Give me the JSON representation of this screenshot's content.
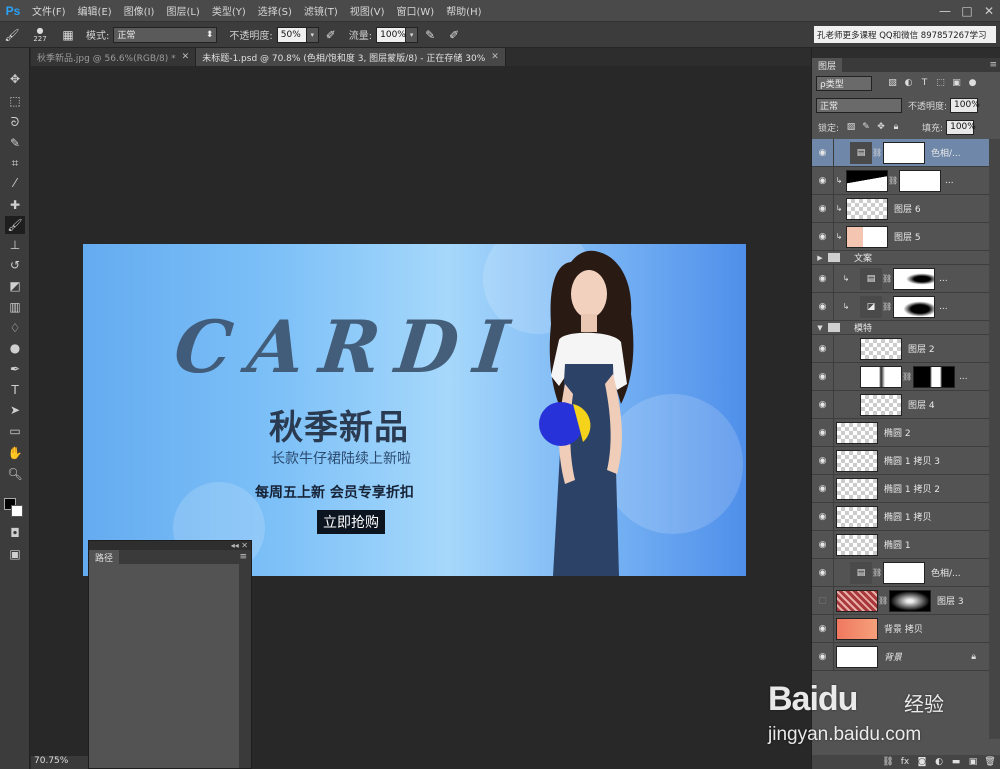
{
  "app": {
    "logo": "Ps"
  },
  "menu": [
    "文件(F)",
    "编辑(E)",
    "图像(I)",
    "图层(L)",
    "类型(Y)",
    "选择(S)",
    "滤镜(T)",
    "视图(V)",
    "窗口(W)",
    "帮助(H)"
  ],
  "window_controls": {
    "minimize": "—",
    "restore": "□",
    "close": "✕"
  },
  "options": {
    "brush_size": "227",
    "mode_label": "模式:",
    "mode_value": "正常",
    "opacity_label": "不透明度:",
    "opacity_value": "50%",
    "flow_label": "流量:",
    "flow_value": "100%",
    "workspace_text": "孔老师更多课程 QQ和微信 897857267学习"
  },
  "tabs": [
    {
      "label": "秋季新品.jpg @ 56.6%(RGB/8) *",
      "active": false
    },
    {
      "label": "未标题-1.psd @ 70.8% (色相/饱和度 3, 图层蒙版/8) - 正在存储 30%",
      "active": true
    }
  ],
  "banner": {
    "brand": "CARDI",
    "title": "秋季新品",
    "subtitle": "长款牛仔裙陆续上新啦",
    "promo": "每周五上新  会员专享折扣",
    "cta": "立即抢购"
  },
  "zoom": "70.75%",
  "paths_panel": {
    "tab": "路径",
    "menu": "≡",
    "top_controls": "◂◂ ✕"
  },
  "layers_panel": {
    "tab": "图层",
    "menu": "≡",
    "filter_kind": "ρ类型",
    "blend_mode": "正常",
    "opacity_label": "不透明度:",
    "opacity_value": "100%",
    "lock_label": "锁定:",
    "fill_label": "填充:",
    "fill_value": "100%",
    "layers": [
      {
        "name": "色相/...",
        "kind": "adjustment",
        "visible": true,
        "selected": true
      },
      {
        "name": "...",
        "kind": "clip-mask",
        "visible": true
      },
      {
        "name": "图层 6",
        "kind": "clip",
        "visible": true
      },
      {
        "name": "图层 5",
        "kind": "clip",
        "visible": true
      },
      {
        "name": "文案",
        "kind": "group-collapsed",
        "visible": true
      },
      {
        "name": "...",
        "kind": "clip-adjust-mask",
        "visible": true
      },
      {
        "name": "...",
        "kind": "clip-adjust-mask2",
        "visible": true
      },
      {
        "name": "模特",
        "kind": "group-open",
        "visible": true
      },
      {
        "name": "图层 2",
        "kind": "pixel",
        "visible": true
      },
      {
        "name": "...",
        "kind": "pixel-mask",
        "visible": true
      },
      {
        "name": "图层 4",
        "kind": "pixel",
        "visible": true
      },
      {
        "name": "椭圆 2",
        "kind": "shape",
        "visible": true
      },
      {
        "name": "椭圆 1 拷贝 3",
        "kind": "shape",
        "visible": true
      },
      {
        "name": "椭圆 1 拷贝 2",
        "kind": "shape",
        "visible": true
      },
      {
        "name": "椭圆 1 拷贝",
        "kind": "shape",
        "visible": true
      },
      {
        "name": "椭圆 1",
        "kind": "shape",
        "visible": true
      },
      {
        "name": "色相/...",
        "kind": "adjustment2",
        "visible": true
      },
      {
        "name": "图层 3",
        "kind": "pixel-mask-dark",
        "visible": false
      },
      {
        "name": "背景 拷贝",
        "kind": "fill",
        "visible": true
      },
      {
        "name": "背景",
        "kind": "background",
        "visible": true
      }
    ]
  },
  "watermark": {
    "logo": "Baidu",
    "jingyan": "经验",
    "url": "jingyan.baidu.com"
  }
}
